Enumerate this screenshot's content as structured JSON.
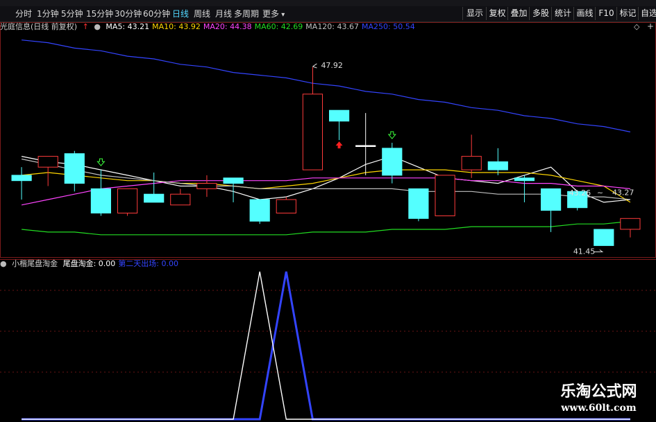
{
  "toolbar": {
    "periods": [
      "分时",
      "1分钟",
      "5分钟",
      "15分钟",
      "30分钟",
      "60分钟",
      "日线",
      "周线",
      "月线",
      "多周期",
      "更多"
    ],
    "active_period": "日线",
    "right_buttons": [
      "显示",
      "复权",
      "叠加",
      "多股",
      "统计",
      "画线",
      "F10",
      "标记",
      "自选"
    ]
  },
  "main_chart": {
    "title": "光庭信息(日线 前复权)",
    "ma_items": [
      {
        "label": "MA5: 43.21",
        "color": "#ffffff"
      },
      {
        "label": "MA10: 43.92",
        "color": "#ffd700"
      },
      {
        "label": "MA20: 44.38",
        "color": "#ff44ff"
      },
      {
        "label": "MA60: 42.69",
        "color": "#22dd22"
      },
      {
        "label": "MA120: 43.67",
        "color": "#c0c0c0"
      },
      {
        "label": "MA250: 50.54",
        "color": "#3344ff"
      }
    ],
    "annotations": {
      "high": "47.92",
      "mid": "43.26",
      "mid_right": "43.27",
      "low": "41.45"
    }
  },
  "sub_chart": {
    "title": "小楷尾盘淘金",
    "items": [
      {
        "label": "尾盘淘金: 0.00",
        "color": "#ffffff"
      },
      {
        "label": "第二天出场: 0.00",
        "color": "#3344ff"
      }
    ]
  },
  "chart_data": [
    {
      "type": "candlestick",
      "title": "光庭信息(日线 前复权)",
      "candles": [
        {
          "open": 43.7,
          "high": 44.2,
          "low": 43.0,
          "close": 43.9,
          "dir": "down"
        },
        {
          "open": 44.2,
          "high": 44.5,
          "low": 43.5,
          "close": 44.6,
          "dir": "up"
        },
        {
          "open": 44.7,
          "high": 44.8,
          "low": 43.3,
          "close": 43.6,
          "dir": "down"
        },
        {
          "open": 43.4,
          "high": 44.1,
          "low": 42.4,
          "close": 42.5,
          "dir": "down"
        },
        {
          "open": 42.5,
          "high": 43.1,
          "low": 42.4,
          "close": 43.4,
          "dir": "up"
        },
        {
          "open": 43.2,
          "high": 44.0,
          "low": 43.0,
          "close": 42.9,
          "dir": "down"
        },
        {
          "open": 42.8,
          "high": 43.4,
          "low": 42.8,
          "close": 43.2,
          "dir": "up"
        },
        {
          "open": 43.4,
          "high": 43.9,
          "low": 43.1,
          "close": 43.6,
          "dir": "up"
        },
        {
          "open": 43.8,
          "high": 43.8,
          "low": 42.9,
          "close": 43.6,
          "dir": "down"
        },
        {
          "open": 43.0,
          "high": 43.0,
          "low": 42.1,
          "close": 42.2,
          "dir": "down"
        },
        {
          "open": 42.5,
          "high": 43.1,
          "low": 42.5,
          "close": 43.0,
          "dir": "up"
        },
        {
          "open": 44.1,
          "high": 47.9,
          "low": 44.1,
          "close": 46.9,
          "dir": "up"
        },
        {
          "open": 46.3,
          "high": 46.3,
          "low": 45.2,
          "close": 45.9,
          "dir": "down"
        },
        {
          "open": 45.0,
          "high": 46.2,
          "low": 43.9,
          "close": 45.0,
          "dir": "flat"
        },
        {
          "open": 44.9,
          "high": 45.1,
          "low": 43.6,
          "close": 43.9,
          "dir": "down"
        },
        {
          "open": 43.4,
          "high": 43.4,
          "low": 42.2,
          "close": 42.3,
          "dir": "down"
        },
        {
          "open": 42.4,
          "high": 43.9,
          "low": 42.4,
          "close": 43.9,
          "dir": "up"
        },
        {
          "open": 44.1,
          "high": 45.4,
          "low": 43.8,
          "close": 44.6,
          "dir": "up"
        },
        {
          "open": 44.4,
          "high": 44.9,
          "low": 43.9,
          "close": 44.1,
          "dir": "down"
        },
        {
          "open": 43.8,
          "high": 43.9,
          "low": 42.9,
          "close": 43.7,
          "dir": "down"
        },
        {
          "open": 43.4,
          "high": 43.4,
          "low": 41.8,
          "close": 42.6,
          "dir": "down"
        },
        {
          "open": 43.3,
          "high": 43.3,
          "low": 42.6,
          "close": 42.7,
          "dir": "down"
        },
        {
          "open": 41.9,
          "high": 41.9,
          "low": 41.4,
          "close": 41.3,
          "dir": "down"
        },
        {
          "open": 41.9,
          "high": 42.3,
          "low": 41.6,
          "close": 42.3,
          "dir": "up"
        }
      ],
      "ylim": [
        40.9,
        49.2
      ],
      "moving_averages": [
        {
          "name": "MA5",
          "color": "#ffffff",
          "values": [
            44.6,
            44.4,
            44.3,
            44.1,
            43.9,
            43.7,
            43.5,
            43.5,
            43.3,
            43.0,
            43.1,
            43.4,
            43.8,
            44.3,
            44.6,
            44.2,
            43.8,
            43.7,
            43.6,
            43.9,
            44.2,
            43.3,
            42.9,
            43.0
          ]
        },
        {
          "name": "MA10",
          "color": "#ffd700",
          "values": [
            43.9,
            44.0,
            43.9,
            43.8,
            43.7,
            43.7,
            43.6,
            43.6,
            43.5,
            43.4,
            43.5,
            43.6,
            43.8,
            44.0,
            44.1,
            44.1,
            44.1,
            44.0,
            44.0,
            44.0,
            43.9,
            43.7,
            43.5,
            42.9
          ]
        },
        {
          "name": "MA20",
          "color": "#ff44ff",
          "values": [
            42.8,
            43.0,
            43.2,
            43.4,
            43.5,
            43.6,
            43.7,
            43.7,
            43.7,
            43.7,
            43.7,
            43.8,
            43.8,
            43.8,
            43.8,
            43.8,
            43.8,
            43.7,
            43.7,
            43.6,
            43.6,
            43.5,
            43.5,
            43.4
          ]
        },
        {
          "name": "MA60",
          "color": "#22dd22",
          "values": [
            41.9,
            41.8,
            41.8,
            41.7,
            41.7,
            41.7,
            41.7,
            41.7,
            41.7,
            41.7,
            41.7,
            41.8,
            41.8,
            41.8,
            41.9,
            41.9,
            41.9,
            42.0,
            42.0,
            42.0,
            42.0,
            42.1,
            42.1,
            42.2
          ]
        },
        {
          "name": "MA120",
          "color": "#c0c0c0",
          "values": [
            44.5,
            44.3,
            44.1,
            43.9,
            43.8,
            43.7,
            43.6,
            43.5,
            43.5,
            43.4,
            43.4,
            43.4,
            43.4,
            43.4,
            43.4,
            43.3,
            43.3,
            43.3,
            43.2,
            43.2,
            43.2,
            43.1,
            43.1,
            43.0
          ]
        },
        {
          "name": "MA250",
          "color": "#3344ff",
          "values": [
            48.9,
            48.8,
            48.6,
            48.5,
            48.3,
            48.2,
            48.0,
            47.9,
            47.7,
            47.6,
            47.5,
            47.3,
            47.2,
            47.0,
            46.9,
            46.7,
            46.6,
            46.4,
            46.3,
            46.1,
            46.0,
            45.8,
            45.7,
            45.5
          ]
        }
      ],
      "markers": [
        {
          "index": 3,
          "kind": "green-down-arrow"
        },
        {
          "index": 12,
          "kind": "red-up-arrow"
        },
        {
          "index": 14,
          "kind": "green-down-arrow"
        }
      ],
      "price_labels": [
        {
          "index": 11,
          "value": 47.92,
          "text": "47.92"
        },
        {
          "index": 21,
          "value": 43.26,
          "text": "43.26"
        },
        {
          "index": 23,
          "value": 43.27,
          "text": "43.27"
        },
        {
          "index": 22,
          "value": 41.45,
          "text": "41.45"
        }
      ]
    },
    {
      "type": "line",
      "title": "小楷尾盘淘金",
      "ylim": [
        0,
        1
      ],
      "series": [
        {
          "name": "尾盘淘金",
          "color": "#ffffff",
          "values": [
            0,
            0,
            0,
            0,
            0,
            0,
            0,
            0,
            0,
            1,
            0,
            0,
            0,
            0,
            0,
            0,
            0,
            0,
            0,
            0,
            0,
            0,
            0,
            0
          ]
        },
        {
          "name": "第二天出场",
          "color": "#3344ff",
          "values": [
            0,
            0,
            0,
            0,
            0,
            0,
            0,
            0,
            0,
            0,
            1,
            0,
            0,
            0,
            0,
            0,
            0,
            0,
            0,
            0,
            0,
            0,
            0,
            0
          ]
        }
      ]
    }
  ],
  "watermark": {
    "name": "乐淘公式网",
    "url": "www.60lt.com"
  }
}
